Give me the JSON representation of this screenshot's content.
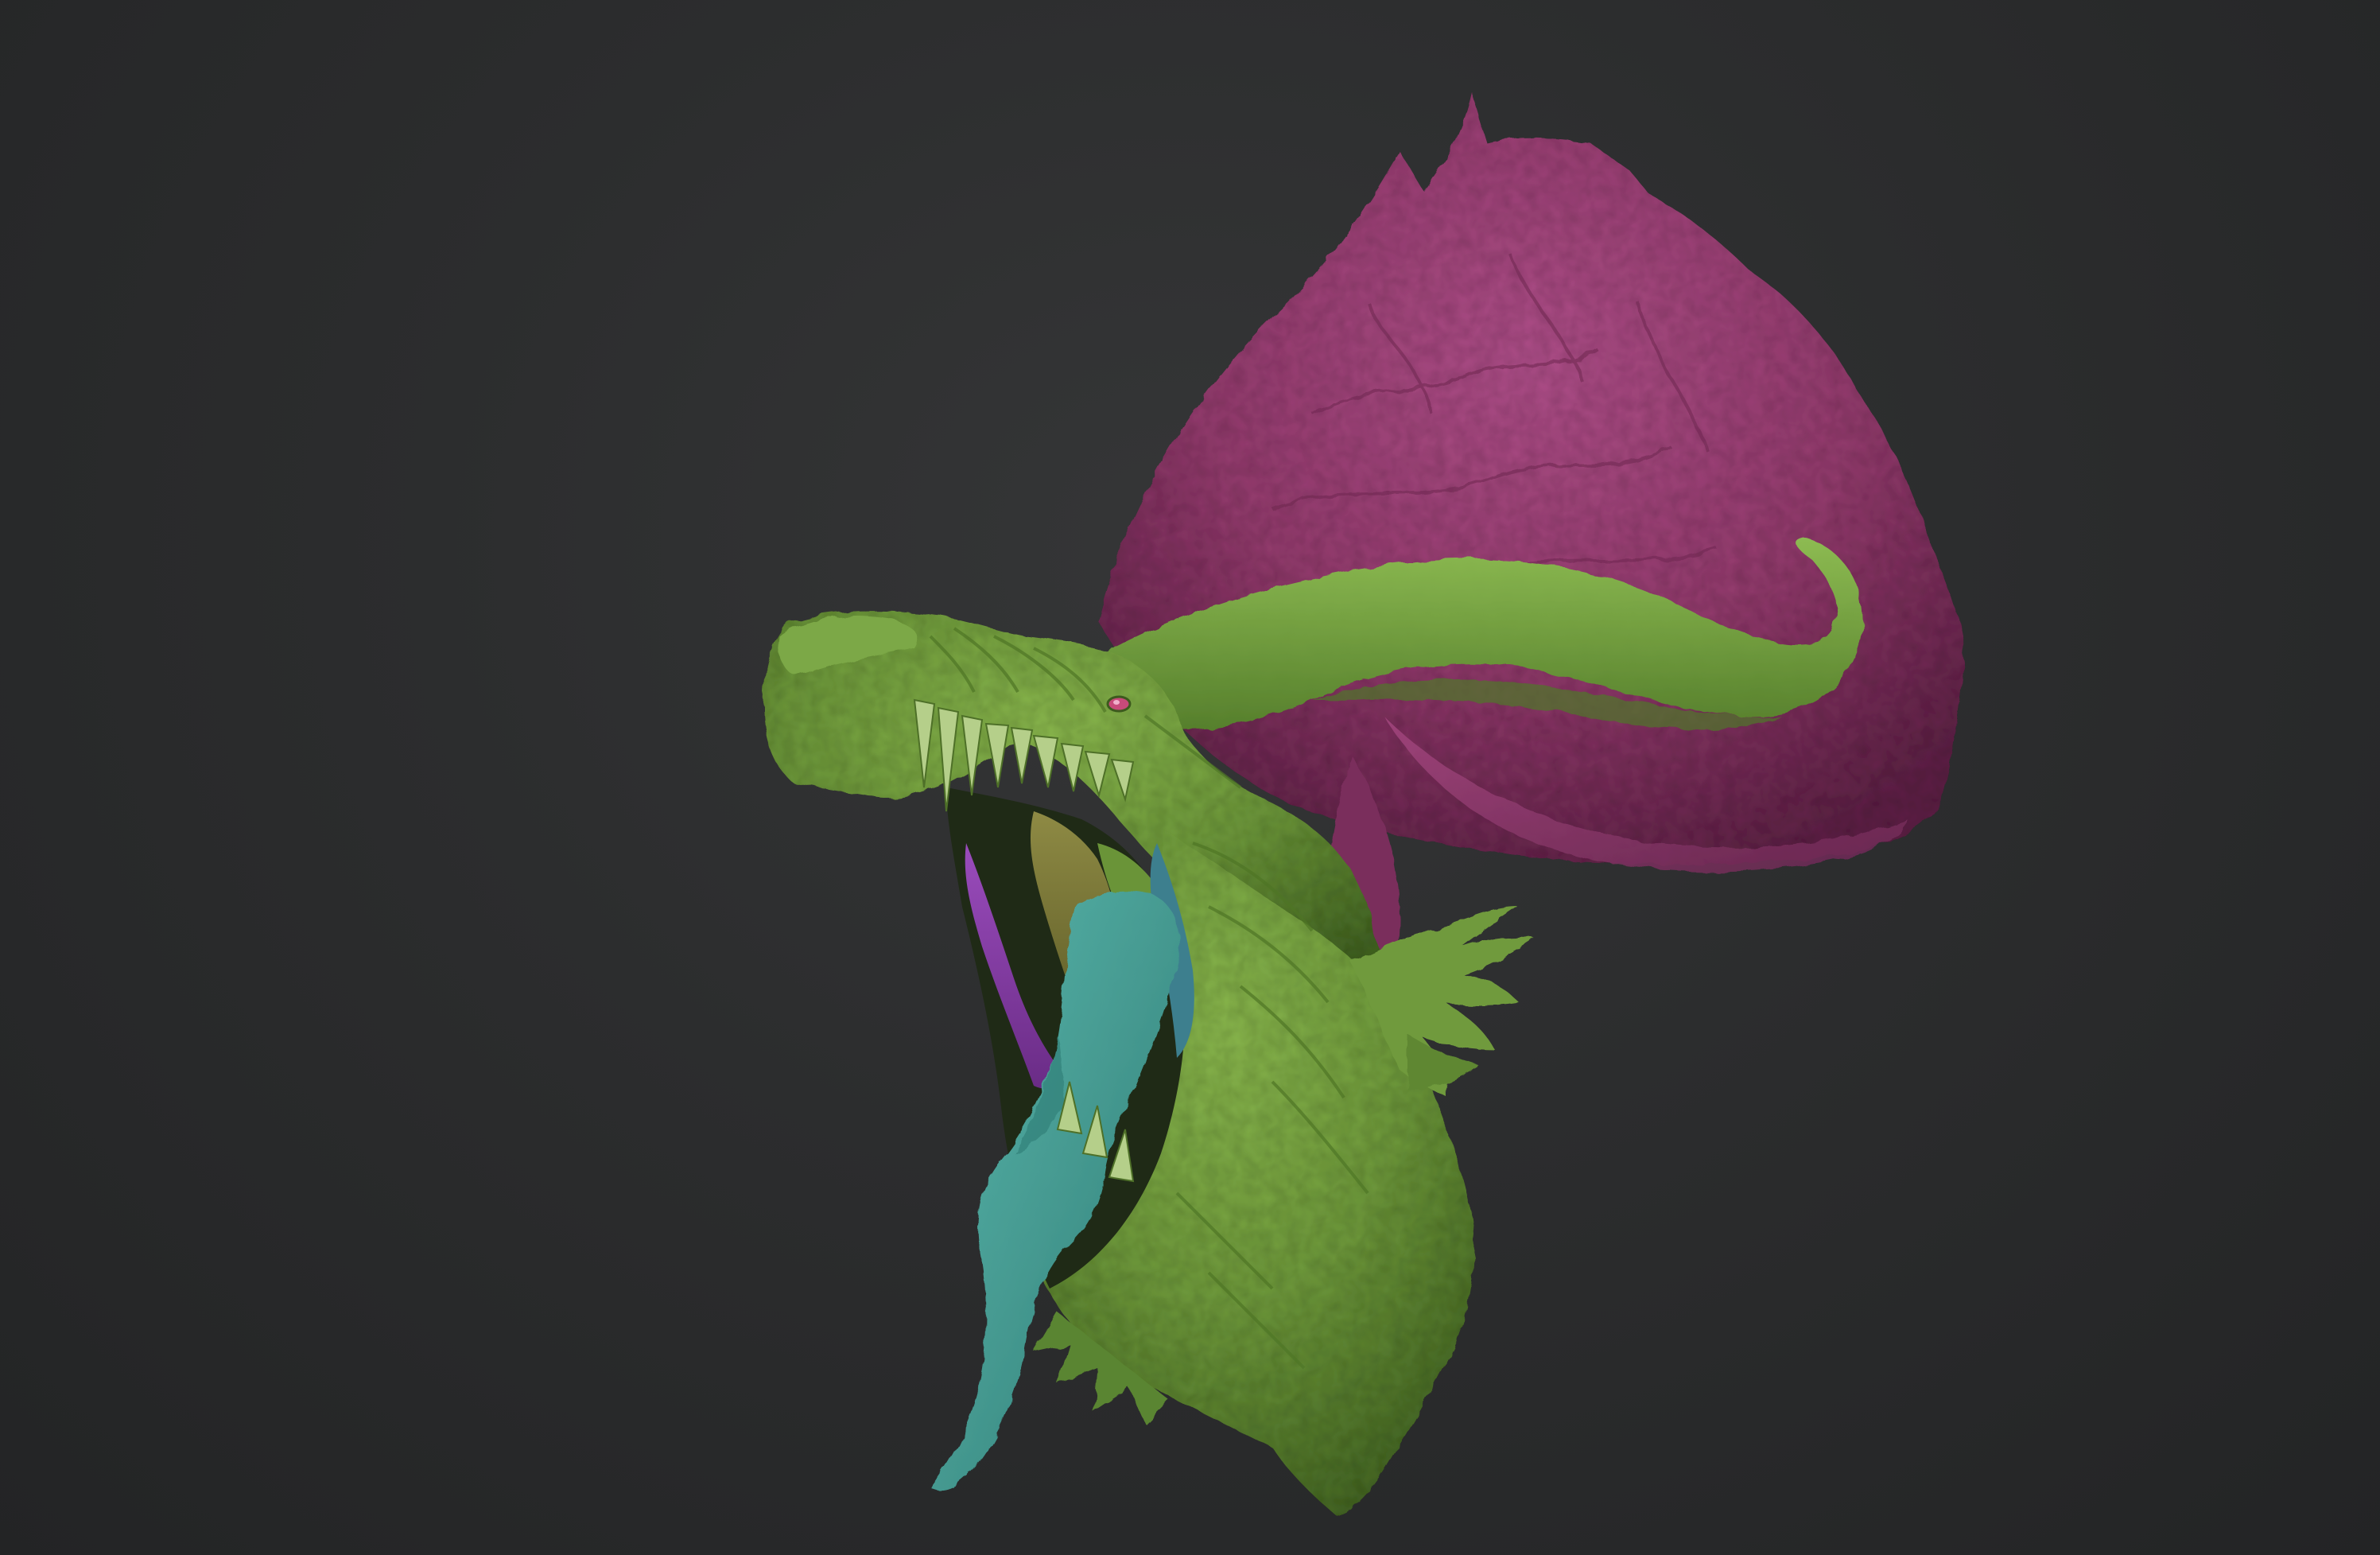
{
  "viewport": {
    "background": "#2c2d2e",
    "subject": "sculpted-creature-head",
    "polygroup_colors": {
      "skin_green": "#6f9a3c",
      "neck_magenta": "#9a3f72",
      "tongue_teal": "#4aa39a",
      "gum_purple": "#8a3fa8",
      "palate_olive": "#7c7a3a",
      "throat_blue": "#3d7f8e",
      "eye": "#c84a7a"
    }
  }
}
